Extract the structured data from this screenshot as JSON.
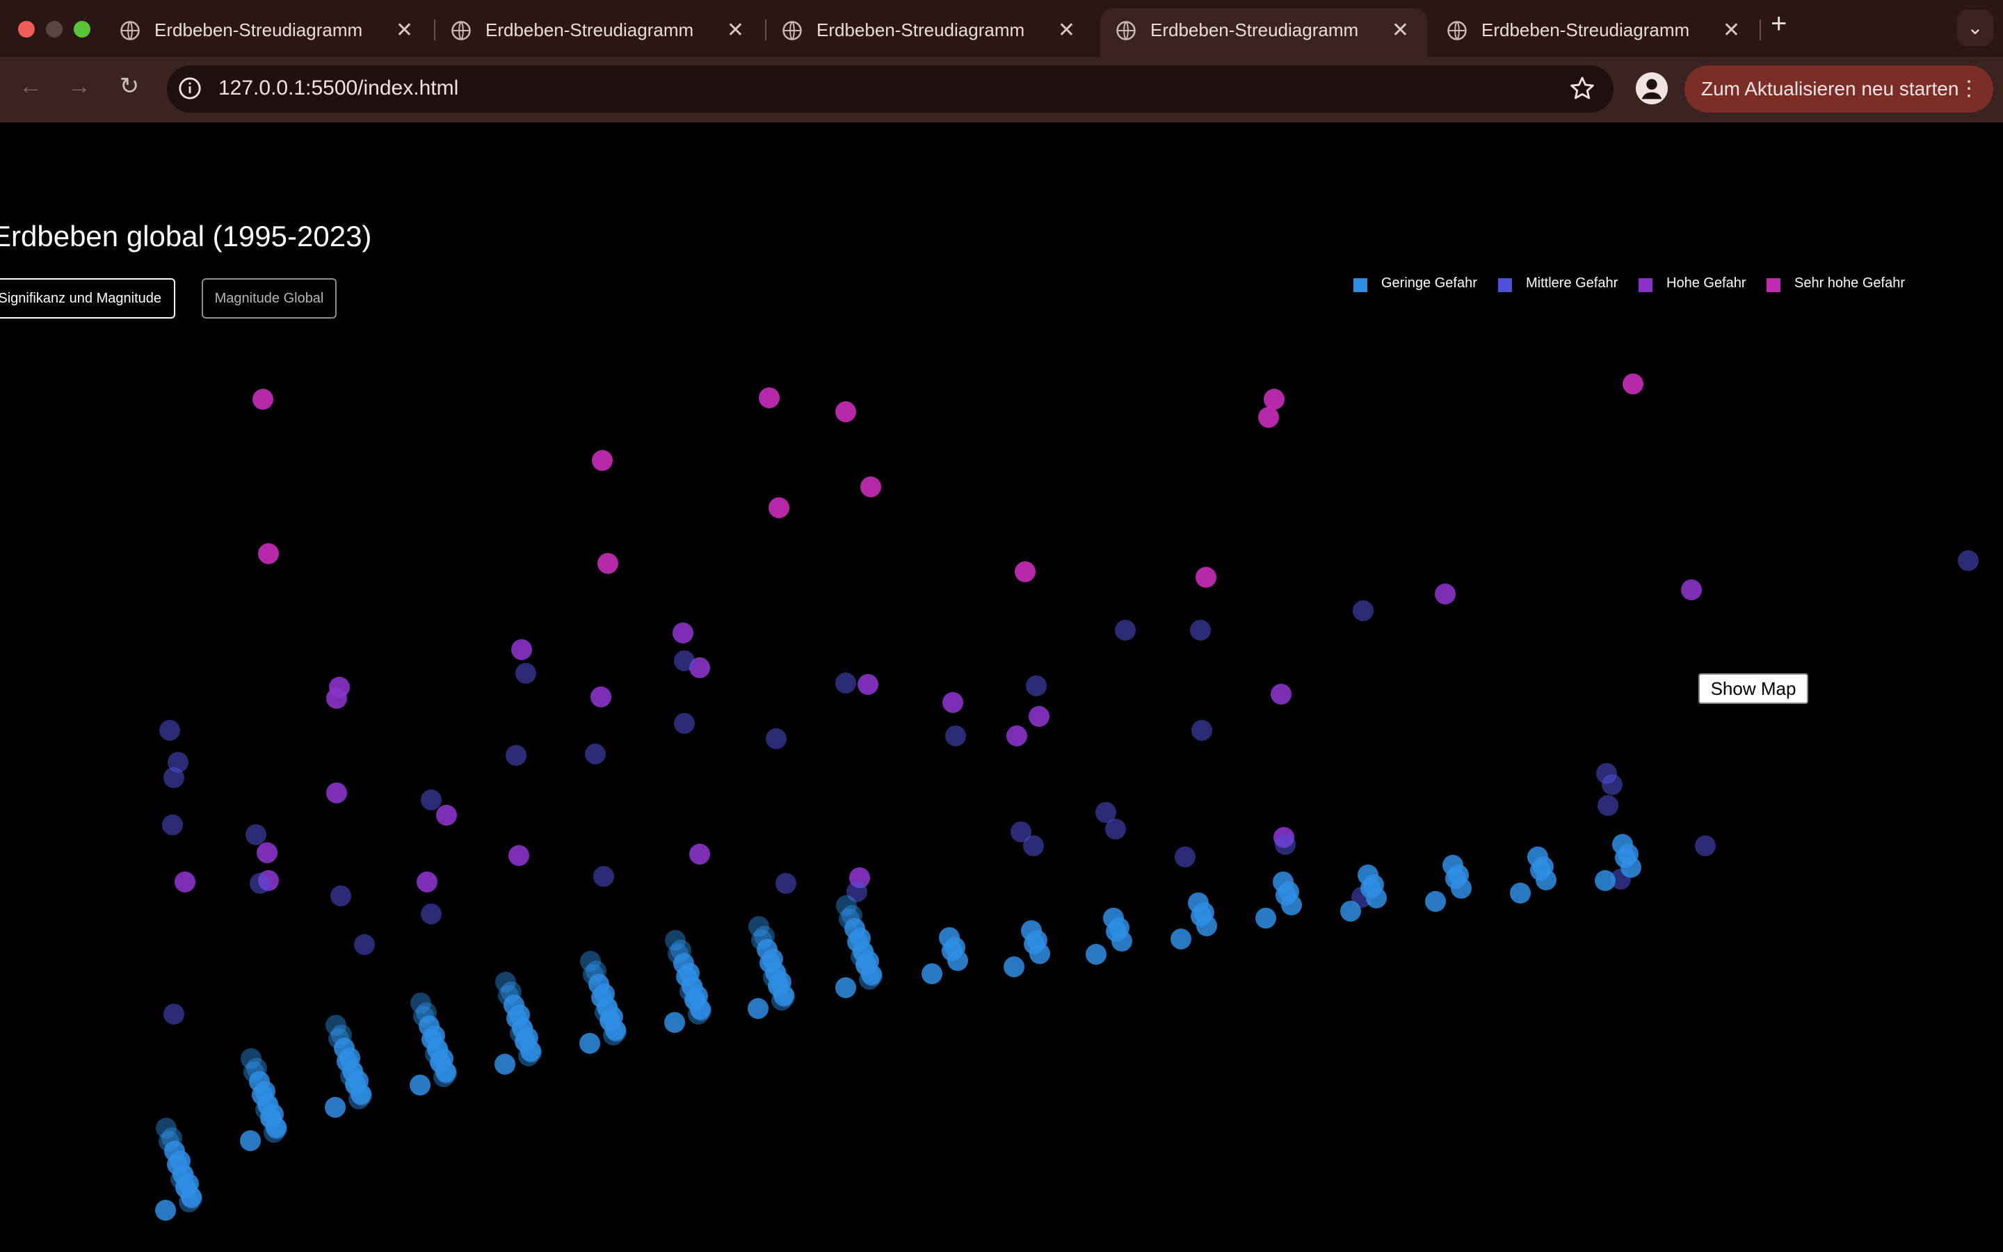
{
  "browser": {
    "tabs": [
      {
        "title": "Erdbeben-Streudiagramm",
        "active": false
      },
      {
        "title": "Erdbeben-Streudiagramm",
        "active": false
      },
      {
        "title": "Erdbeben-Streudiagramm",
        "active": false
      },
      {
        "title": "Erdbeben-Streudiagramm",
        "active": true
      },
      {
        "title": "Erdbeben-Streudiagramm",
        "active": false
      }
    ],
    "tab_icon": "globe-icon",
    "url": "127.0.0.1:5500/index.html",
    "restart_label": "Zum Aktualisieren neu starten"
  },
  "page": {
    "title": "Erdbeben global (1995-2023)",
    "buttons": {
      "significance": "Signifikanz und Magnitude",
      "magnitude": "Magnitude Global"
    },
    "show_map": "Show Map"
  },
  "chart_data": {
    "type": "scatter",
    "grid": false,
    "legend_position": "top-right",
    "series": [
      {
        "name": "Geringe Gefahr",
        "color": "#2f8de4"
      },
      {
        "name": "Mittlere Gefahr",
        "color": "#4e51d6"
      },
      {
        "name": "Hohe Gefahr",
        "color": "#8a33c9"
      },
      {
        "name": "Sehr hohe Gefahr",
        "color": "#c42bb5"
      }
    ]
  }
}
